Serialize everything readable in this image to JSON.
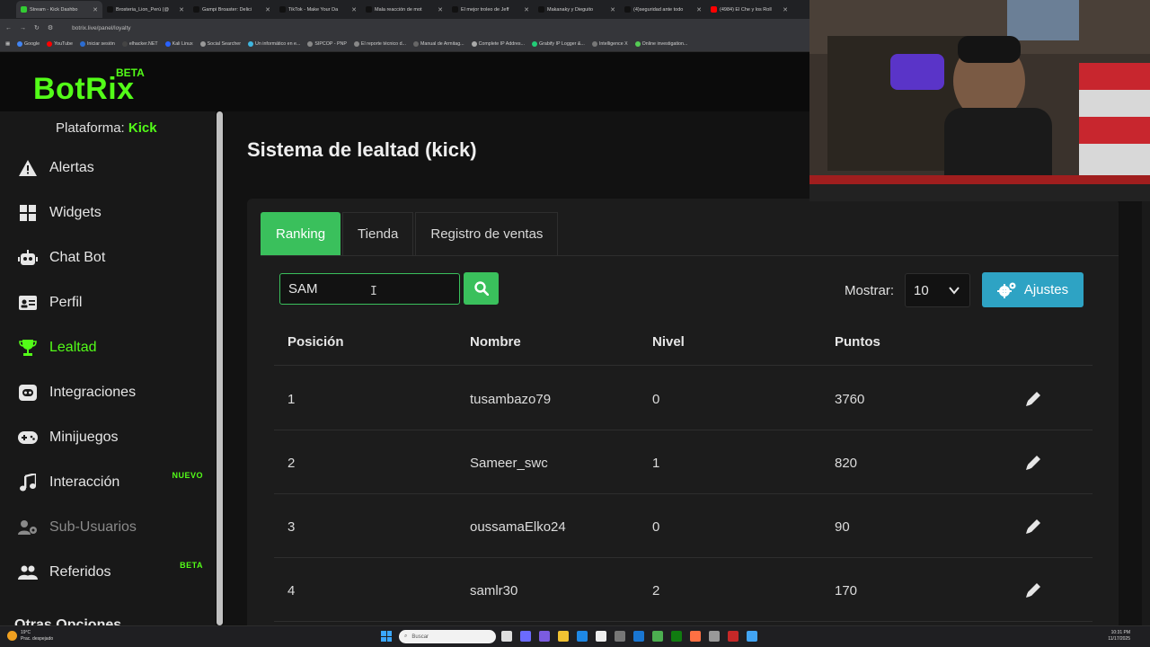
{
  "browser": {
    "tabs": [
      {
        "title": "Stream - Kick Dashbo",
        "icon_color": "#53fc18",
        "active": true
      },
      {
        "title": "Brosteria_Lion_Perú (@",
        "icon_color": "#000000"
      },
      {
        "title": "Gampi Broaster: Delici",
        "icon_color": "#000000"
      },
      {
        "title": "TikTok - Make Your Da",
        "icon_color": "#000000"
      },
      {
        "title": "Mala reacción de mot",
        "icon_color": "#000000"
      },
      {
        "title": "El mejor troleo de Jeff",
        "icon_color": "#000000"
      },
      {
        "title": "Makanaky y Dieguito",
        "icon_color": "#000000"
      },
      {
        "title": "(4)seguridad ante todo",
        "icon_color": "#000000"
      },
      {
        "title": "(4984) El Che y los Roll",
        "icon_color": "#ff0000"
      }
    ],
    "url": "botrix.live/panel/loyalty",
    "bookmarks": [
      "Google",
      "YouTube",
      "Iniciar sesión",
      "elhacker.NET",
      "Kali Linux",
      "Social Searcher",
      "Un informático en e...",
      "SIPCOP - PNP",
      "El reporte técnico d...",
      "Manual de Armitag...",
      "Complete IP Addres...",
      "Grabify IP Logger &...",
      "Intelligence X",
      "Online investigation..."
    ]
  },
  "app": {
    "logo": "BotRix",
    "logo_badge": "BETA",
    "platform_label": "Plataforma:",
    "platform_value": "Kick"
  },
  "sidebar": {
    "items": [
      {
        "label": "Alertas",
        "icon": "warning-icon"
      },
      {
        "label": "Widgets",
        "icon": "grid-icon"
      },
      {
        "label": "Chat Bot",
        "icon": "robot-icon"
      },
      {
        "label": "Perfil",
        "icon": "id-card-icon"
      },
      {
        "label": "Lealtad",
        "icon": "trophy-icon",
        "active": true
      },
      {
        "label": "Integraciones",
        "icon": "discord-icon"
      },
      {
        "label": "Minijuegos",
        "icon": "gamepad-icon"
      },
      {
        "label": "Interacción",
        "icon": "music-icon",
        "badge": "NUEVO"
      },
      {
        "label": "Sub-Usuarios",
        "icon": "users-cog-icon",
        "muted": true
      },
      {
        "label": "Referidos",
        "icon": "users-icon",
        "badge": "BETA"
      }
    ],
    "other_options": "Otras Opciones"
  },
  "main": {
    "title": "Sistema de lealtad (kick)",
    "tabs": [
      {
        "label": "Ranking",
        "active": true
      },
      {
        "label": "Tienda"
      },
      {
        "label": "Registro de ventas"
      }
    ],
    "search": {
      "value": "SAM",
      "placeholder": ""
    },
    "show_label": "Mostrar:",
    "show_value": "10",
    "settings_label": "Ajustes",
    "table": {
      "columns": [
        "Posición",
        "Nombre",
        "Nivel",
        "Puntos"
      ],
      "rows": [
        {
          "pos": "1",
          "name": "tusambazo79",
          "level": "0",
          "points": "3760"
        },
        {
          "pos": "2",
          "name": "Sameer_swc",
          "level": "1",
          "points": "820"
        },
        {
          "pos": "3",
          "name": "oussamaElko24",
          "level": "0",
          "points": "90"
        },
        {
          "pos": "4",
          "name": "samlr30",
          "level": "2",
          "points": "170"
        }
      ]
    }
  },
  "taskbar": {
    "weather_temp": "19°C",
    "weather_desc": "Prac. despejado",
    "search_placeholder": "Buscar",
    "time": "10:31 PM",
    "date": "11/17/2025"
  },
  "colors": {
    "accent": "#53fc18",
    "button_green": "#3ac05c",
    "button_blue": "#2ea3c4",
    "background": "#121212",
    "sidebar": "#181818"
  }
}
